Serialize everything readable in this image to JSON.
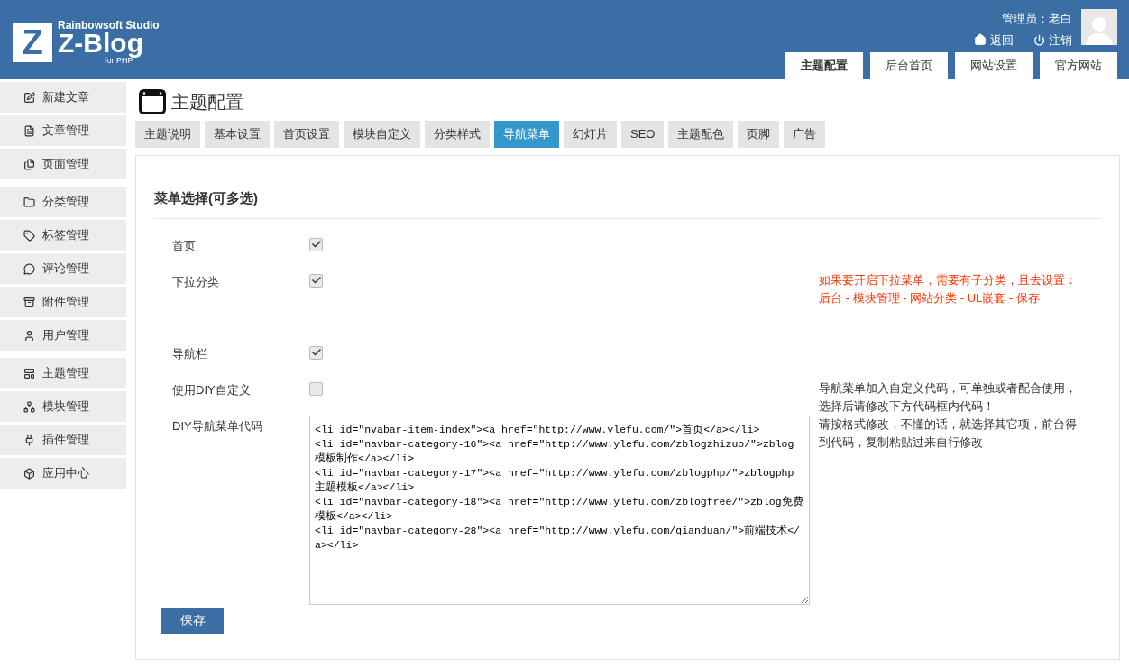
{
  "header": {
    "logo_mark": "Z",
    "logo_studio": "Rainbowsoft Studio",
    "logo_name": "Z-Blog",
    "logo_sub": "for PHP",
    "user_label": "管理员：老白",
    "links": [
      {
        "kind": "home",
        "label": "返回"
      },
      {
        "kind": "power",
        "label": "注销"
      }
    ]
  },
  "top_tabs": [
    {
      "label": "主题配置",
      "selected": true
    },
    {
      "label": "后台首页",
      "selected": false
    },
    {
      "label": "网站设置",
      "selected": false
    },
    {
      "label": "官方网站",
      "selected": false
    }
  ],
  "sidebar": {
    "groups": [
      [
        {
          "label": "新建文章"
        },
        {
          "label": "文章管理"
        },
        {
          "label": "页面管理"
        }
      ],
      [
        {
          "label": "分类管理"
        },
        {
          "label": "标签管理"
        },
        {
          "label": "评论管理"
        },
        {
          "label": "附件管理"
        },
        {
          "label": "用户管理"
        }
      ],
      [
        {
          "label": "主题管理"
        },
        {
          "label": "模块管理"
        },
        {
          "label": "插件管理"
        },
        {
          "label": "应用中心"
        }
      ]
    ]
  },
  "page_title": "主题配置",
  "tabs": [
    {
      "label": "主题说明",
      "selected": false
    },
    {
      "label": "基本设置",
      "selected": false
    },
    {
      "label": "首页设置",
      "selected": false
    },
    {
      "label": "模块自定义",
      "selected": false
    },
    {
      "label": "分类样式",
      "selected": false
    },
    {
      "label": "导航菜单",
      "selected": true
    },
    {
      "label": "幻灯片",
      "selected": false
    },
    {
      "label": "SEO",
      "selected": false
    },
    {
      "label": "主题配色",
      "selected": false
    },
    {
      "label": "页脚",
      "selected": false
    },
    {
      "label": "广告",
      "selected": false
    }
  ],
  "section_title": "菜单选择(可多选)",
  "rows": [
    {
      "kind": "checkbox",
      "label": "首页",
      "checked": true
    },
    {
      "kind": "checkbox",
      "label": "下拉分类",
      "checked": true,
      "note": "如果要开启下拉菜单，需要有子分类，且去设置：后台 - 模块管理 - 网站分类 - UL嵌套 - 保存",
      "note_warning": true
    },
    {
      "kind": "checkbox",
      "label": "导航栏",
      "checked": true
    },
    {
      "kind": "checkbox",
      "label": "使用DIY自定义",
      "checked": false,
      "note": "导航菜单加入自定义代码，可单独或者配合使用，选择后请修改下方代码框内代码！",
      "note_warning": false
    },
    {
      "kind": "code",
      "label": "DIY导航菜单代码",
      "value": "<li id=\"nvabar-item-index\"><a href=\"http://www.ylefu.com/\">首页</a></li>\n<li id=\"navbar-category-16\"><a href=\"http://www.ylefu.com/zblogzhizuo/\">zblog模板制作</a></li>\n<li id=\"navbar-category-17\"><a href=\"http://www.ylefu.com/zblogphp/\">zblogphp主题模板</a></li>\n<li id=\"navbar-category-18\"><a href=\"http://www.ylefu.com/zblogfree/\">zblog免费模板</a></li>\n<li id=\"navbar-category-28\"><a href=\"http://www.ylefu.com/qianduan/\">前端技术</a></li>",
      "note": "请按格式修改，不懂的话，就选择其它项，前台得到代码，复制粘贴过来自行修改",
      "note_warning": false
    }
  ],
  "save_button": "保存"
}
